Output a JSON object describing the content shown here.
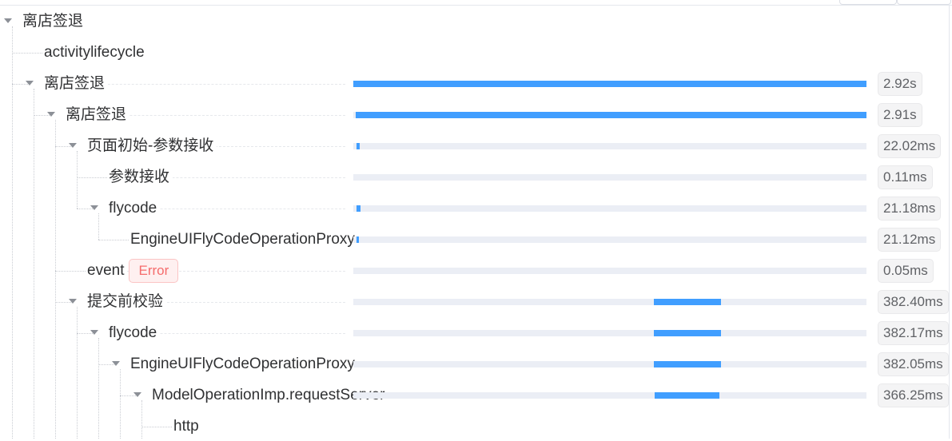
{
  "tree": {
    "rows": [
      {
        "label": "离店签退",
        "depth": 0,
        "expanded": true,
        "has_bar": false
      },
      {
        "label": "activitylifecycle",
        "depth": 1,
        "expanded": false,
        "has_bar": false
      },
      {
        "label": "离店签退",
        "depth": 1,
        "expanded": true,
        "has_bar": true,
        "bar_start": 0.0,
        "bar_end": 1.0,
        "duration": "2.92s"
      },
      {
        "label": "离店签退",
        "depth": 2,
        "expanded": true,
        "has_bar": true,
        "bar_start": 0.004,
        "bar_end": 1.0,
        "duration": "2.91s"
      },
      {
        "label": "页面初始-参数接收",
        "depth": 3,
        "expanded": true,
        "has_bar": true,
        "bar_start": 0.006,
        "bar_end": 0.013,
        "duration": "22.02ms"
      },
      {
        "label": "参数接收",
        "depth": 4,
        "expanded": false,
        "has_bar": true,
        "bar_start": 0.006,
        "bar_end": 0.006,
        "duration": "0.11ms"
      },
      {
        "label": "flycode",
        "depth": 4,
        "expanded": true,
        "has_bar": true,
        "bar_start": 0.007,
        "bar_end": 0.014,
        "duration": "21.18ms"
      },
      {
        "label": "EngineUIFlyCodeOperationProxy",
        "depth": 5,
        "expanded": false,
        "has_bar": true,
        "bar_start": 0.007,
        "bar_end": 0.011,
        "duration": "21.12ms"
      },
      {
        "label": "event",
        "depth": 3,
        "expanded": false,
        "has_bar": true,
        "bar_start": 0.0,
        "bar_end": 0.0,
        "duration": "0.05ms",
        "tag": "Error"
      },
      {
        "label": "提交前校验",
        "depth": 3,
        "expanded": true,
        "has_bar": true,
        "bar_start": 0.586,
        "bar_end": 0.716,
        "duration": "382.40ms"
      },
      {
        "label": "flycode",
        "depth": 4,
        "expanded": true,
        "has_bar": true,
        "bar_start": 0.586,
        "bar_end": 0.716,
        "duration": "382.17ms"
      },
      {
        "label": "EngineUIFlyCodeOperationProxy",
        "depth": 5,
        "expanded": true,
        "has_bar": true,
        "bar_start": 0.586,
        "bar_end": 0.716,
        "duration": "382.05ms"
      },
      {
        "label": "ModelOperationImp.requestServer",
        "depth": 6,
        "expanded": true,
        "has_bar": true,
        "bar_start": 0.588,
        "bar_end": 0.714,
        "duration": "366.25ms"
      },
      {
        "label": "http",
        "depth": 7,
        "expanded": false,
        "has_bar": false
      }
    ]
  },
  "colors": {
    "bar_fill": "#409eff",
    "bar_track": "#ebeef5",
    "error": "#f56c6c"
  }
}
